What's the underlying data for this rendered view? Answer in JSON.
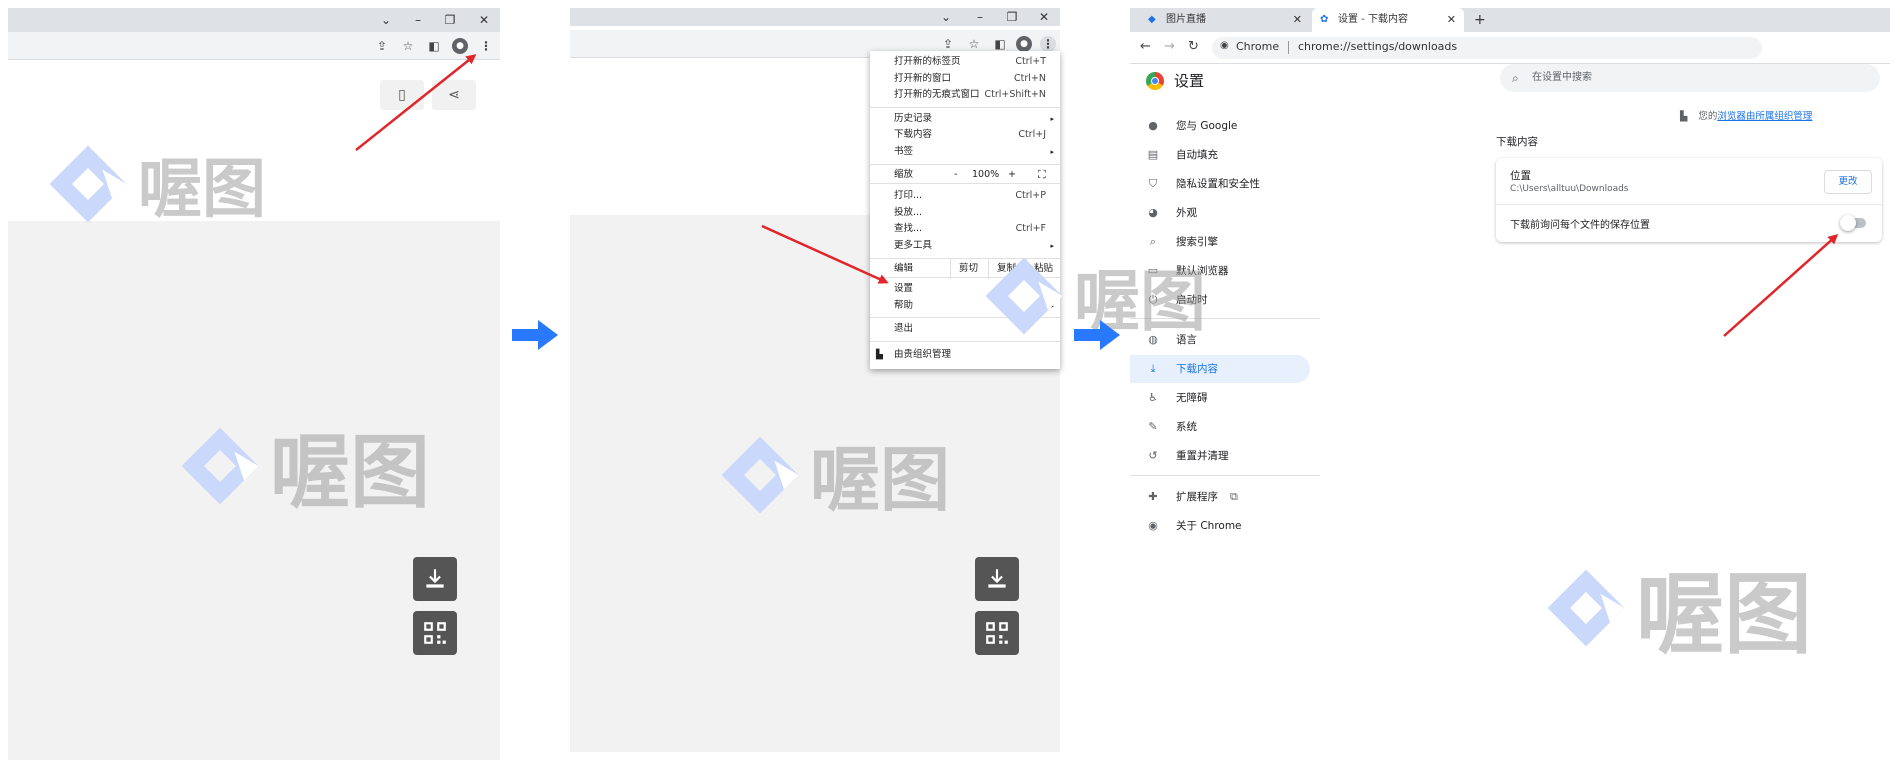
{
  "colors": {
    "accent_blue": "#1a73e8",
    "flow_arrow_blue": "#2979ff",
    "red_arrow": "#e0262b",
    "watermark_blue": "#c9d8fb",
    "watermark_gray": "#9e9e9e"
  },
  "watermark": {
    "text": "喔图"
  },
  "panel1": {
    "window_controls": [
      "⌄",
      "–",
      "❐",
      "✕"
    ],
    "toolbar_icons": [
      "share-icon",
      "star-icon",
      "sidepanel-icon",
      "profile-icon",
      "menu-dots-icon"
    ],
    "page_buttons": [
      "phone-icon",
      "share-icon"
    ],
    "action_buttons": [
      "download-icon",
      "qrcode-icon"
    ]
  },
  "panel2": {
    "menu": {
      "items_top": [
        {
          "label": "打开新的标签页",
          "shortcut": "Ctrl+T"
        },
        {
          "label": "打开新的窗口",
          "shortcut": "Ctrl+N"
        },
        {
          "label": "打开新的无痕式窗口",
          "shortcut": "Ctrl+Shift+N"
        }
      ],
      "items_mid": [
        {
          "label": "历史记录",
          "sub": "▸"
        },
        {
          "label": "下载内容",
          "shortcut": "Ctrl+J"
        },
        {
          "label": "书签",
          "sub": "▸"
        }
      ],
      "zoom": {
        "label": "缩放",
        "minus": "-",
        "value": "100%",
        "plus": "+"
      },
      "items_tools": [
        {
          "label": "打印...",
          "shortcut": "Ctrl+P"
        },
        {
          "label": "投放..."
        },
        {
          "label": "查找...",
          "shortcut": "Ctrl+F"
        },
        {
          "label": "更多工具",
          "sub": "▸"
        }
      ],
      "edit": {
        "label": "编辑",
        "cut": "剪切",
        "copy": "复制",
        "paste": "粘贴"
      },
      "items_bottom": [
        {
          "label": "设置"
        },
        {
          "label": "帮助",
          "sub": "▸"
        }
      ],
      "exit": "退出",
      "managed": "由贵组织管理"
    }
  },
  "panel3": {
    "tabs": [
      {
        "label": "图片直播",
        "close": "✕"
      },
      {
        "label": "设置 - 下载内容",
        "close": "✕"
      }
    ],
    "new_tab": "+",
    "address": {
      "site": "Chrome",
      "url": "chrome://settings/downloads"
    },
    "settings_title": "设置",
    "search_placeholder": "在设置中搜索",
    "managed_notice_prefix": "您的",
    "managed_notice_link": "浏览器由所属组织管理",
    "nav": [
      {
        "label": "您与 Google",
        "icon": "person-icon"
      },
      {
        "label": "自动填充",
        "icon": "clipboard-icon"
      },
      {
        "label": "隐私设置和安全性",
        "icon": "shield-icon"
      },
      {
        "label": "外观",
        "icon": "palette-icon"
      },
      {
        "label": "搜索引擎",
        "icon": "search-icon"
      },
      {
        "label": "默认浏览器",
        "icon": "browser-icon"
      },
      {
        "label": "启动时",
        "icon": "power-icon"
      },
      {
        "label": "语言",
        "icon": "globe-icon"
      },
      {
        "label": "下载内容",
        "icon": "download-icon"
      },
      {
        "label": "无障碍",
        "icon": "accessibility-icon"
      },
      {
        "label": "系统",
        "icon": "wrench-icon"
      },
      {
        "label": "重置并清理",
        "icon": "restore-icon"
      },
      {
        "label": "扩展程序",
        "icon": "puzzle-icon"
      },
      {
        "label": "关于 Chrome",
        "icon": "chrome-icon"
      }
    ],
    "section_title": "下载内容",
    "location_label": "位置",
    "location_path": "C:\\Users\\alltuu\\Downloads",
    "change_button": "更改",
    "ask_label": "下载前询问每个文件的保存位置",
    "ask_toggle_on": false
  }
}
